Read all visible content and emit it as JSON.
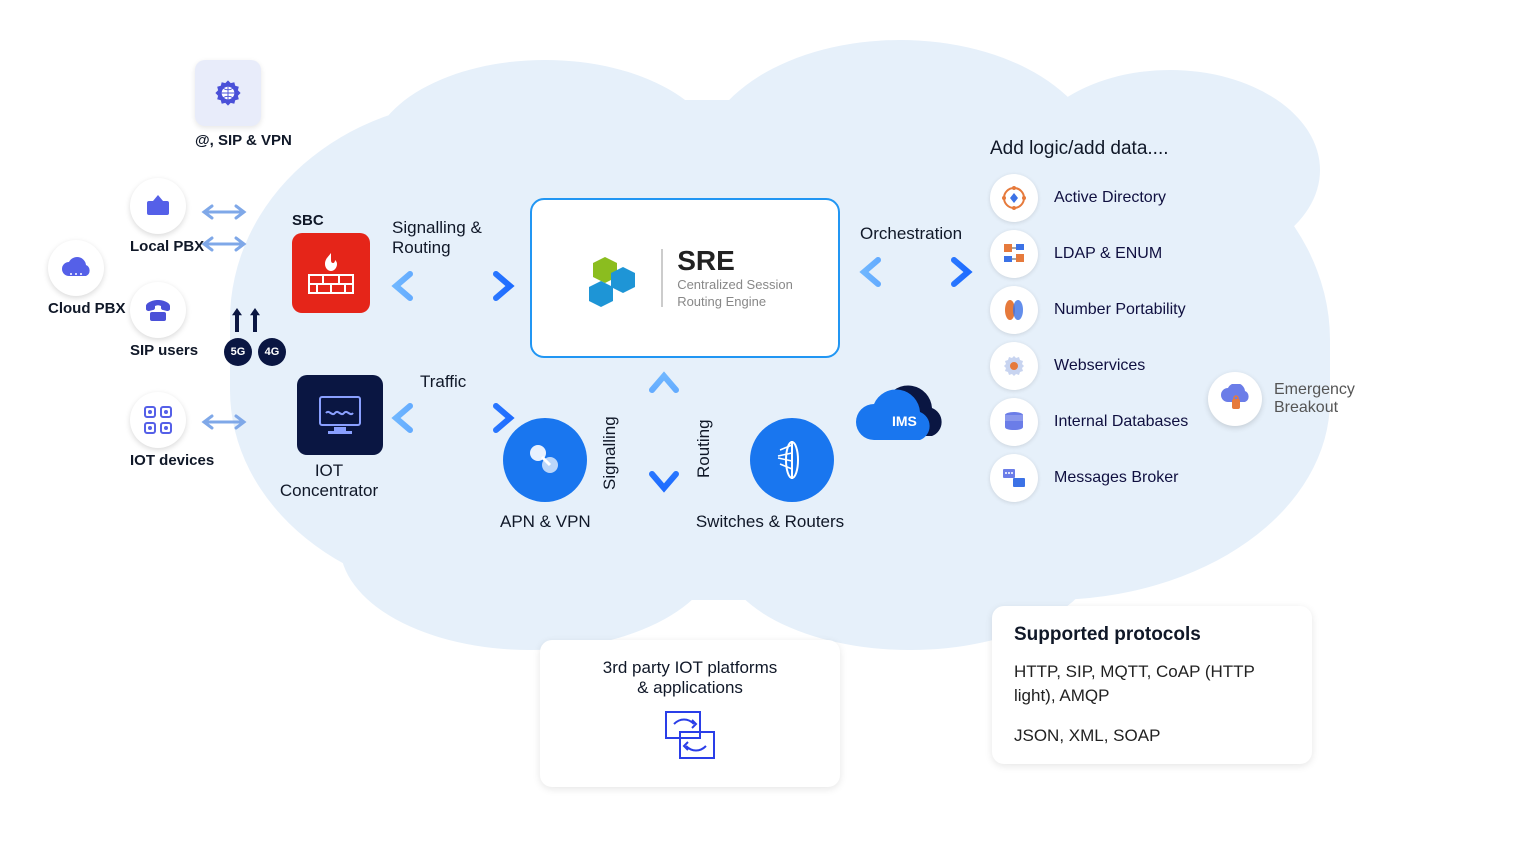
{
  "left_icons": {
    "sip_vpn": "@, SIP & VPN",
    "local_pbx": "Local PBX",
    "cloud_pbx": "Cloud PBX",
    "sip_users": "SIP users",
    "iot_devices": "IOT devices"
  },
  "cellular": {
    "g5": "5G",
    "g4": "4G"
  },
  "sbc": {
    "label": "SBC"
  },
  "iot_conc": {
    "label": "IOT Concentrator"
  },
  "flows": {
    "signalling_routing": "Signalling & Routing",
    "traffic": "Traffic",
    "orchestration": "Orchestration",
    "signalling": "Signalling",
    "routing": "Routing"
  },
  "sre": {
    "title": "SRE",
    "subtitle1": "Centralized Session",
    "subtitle2": "Routing Engine"
  },
  "network": {
    "apn_vpn": "APN & VPN",
    "switches_routers": "Switches & Routers",
    "ims": "IMS"
  },
  "logic": {
    "header": "Add logic/add data....",
    "items": {
      "0": "Active Directory",
      "1": "LDAP & ENUM",
      "2": "Number Portability",
      "3": "Webservices",
      "4": "Internal Databases",
      "5": "Messages Broker"
    }
  },
  "emergency": {
    "label1": "Emergency",
    "label2": "Breakout"
  },
  "third_party": {
    "line1": "3rd party IOT platforms",
    "line2": "& applications"
  },
  "protocols": {
    "title": "Supported protocols",
    "line1": "HTTP, SIP, MQTT,  CoAP (HTTP light), AMQP",
    "line2": "JSON, XML, SOAP"
  }
}
